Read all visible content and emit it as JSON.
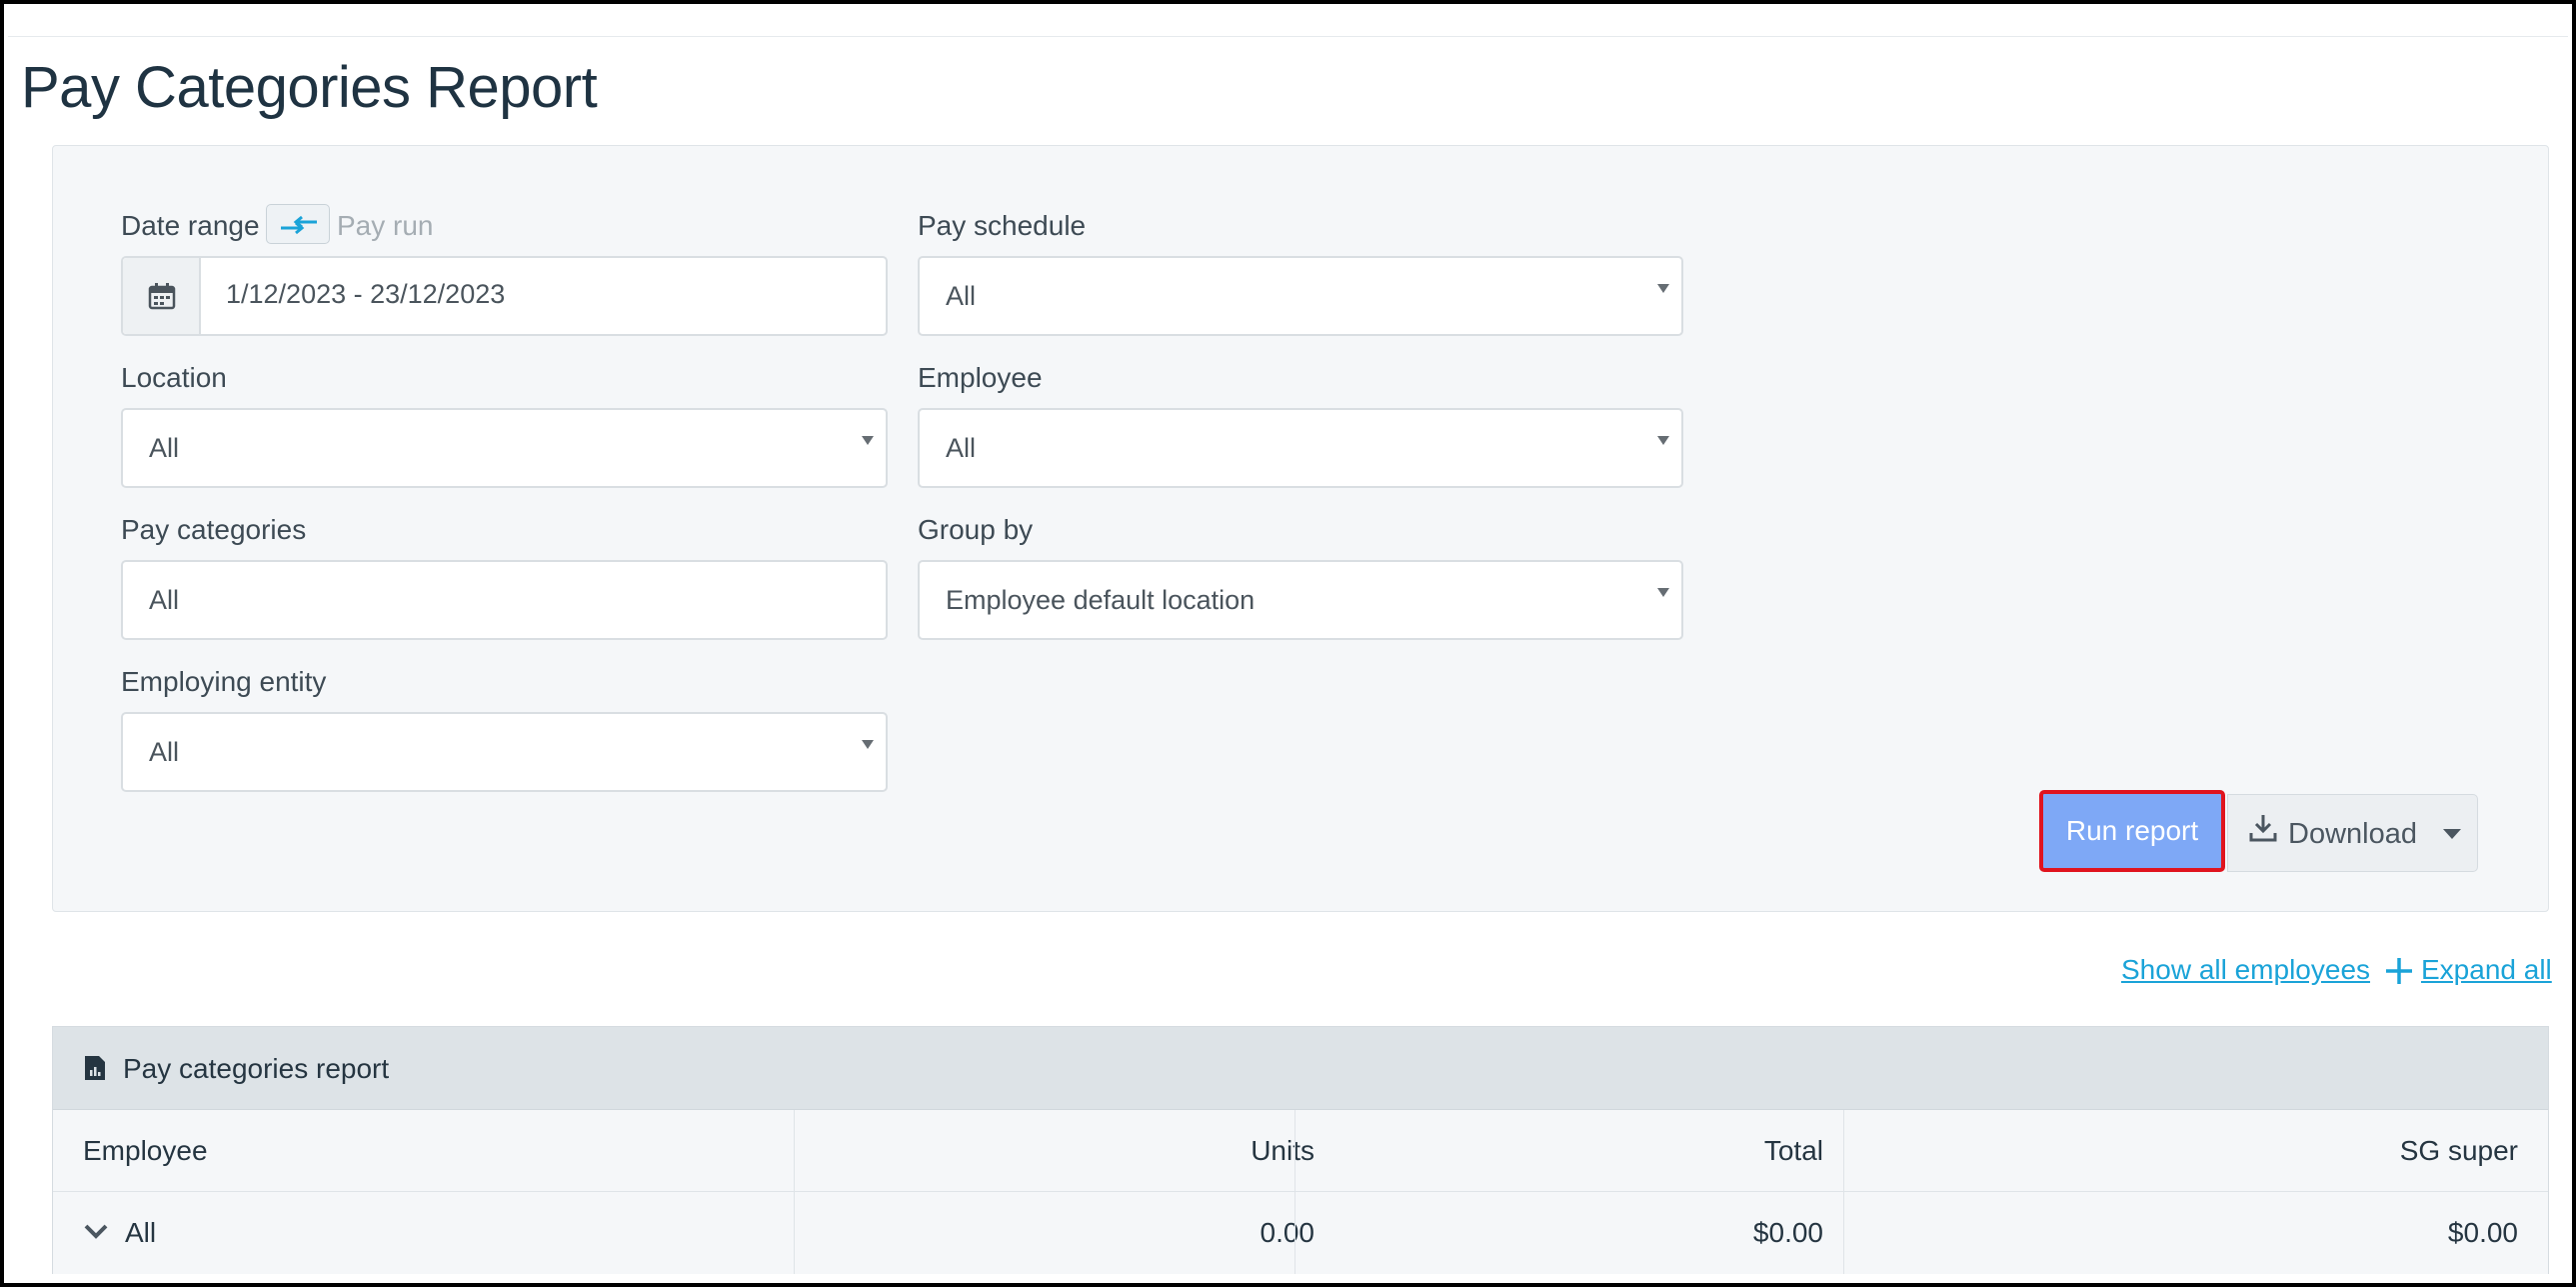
{
  "page": {
    "title": "Pay Categories Report"
  },
  "filters": {
    "date_range_label": "Date range",
    "pay_run_label": "Pay run",
    "date_range_value": "1/12/2023 - 23/12/2023",
    "pay_schedule_label": "Pay schedule",
    "pay_schedule_value": "All",
    "location_label": "Location",
    "location_value": "All",
    "employee_label": "Employee",
    "employee_value": "All",
    "pay_categories_label": "Pay categories",
    "pay_categories_value": "All",
    "group_by_label": "Group by",
    "group_by_value": "Employee default location",
    "employing_entity_label": "Employing entity",
    "employing_entity_value": "All"
  },
  "actions": {
    "run_report": "Run report",
    "download": "Download",
    "show_all_employees": "Show all employees",
    "expand_all": "Expand all"
  },
  "report": {
    "title": "Pay categories report",
    "columns": [
      "Employee",
      "Units",
      "Total",
      "SG super"
    ],
    "rows": [
      {
        "employee": "All",
        "units": "0.00",
        "total": "$0.00",
        "sg_super": "$0.00"
      }
    ]
  },
  "colors": {
    "accent_link": "#1aa3d8",
    "run_button": "#7ea8f6",
    "highlight_border": "#e0141e"
  }
}
